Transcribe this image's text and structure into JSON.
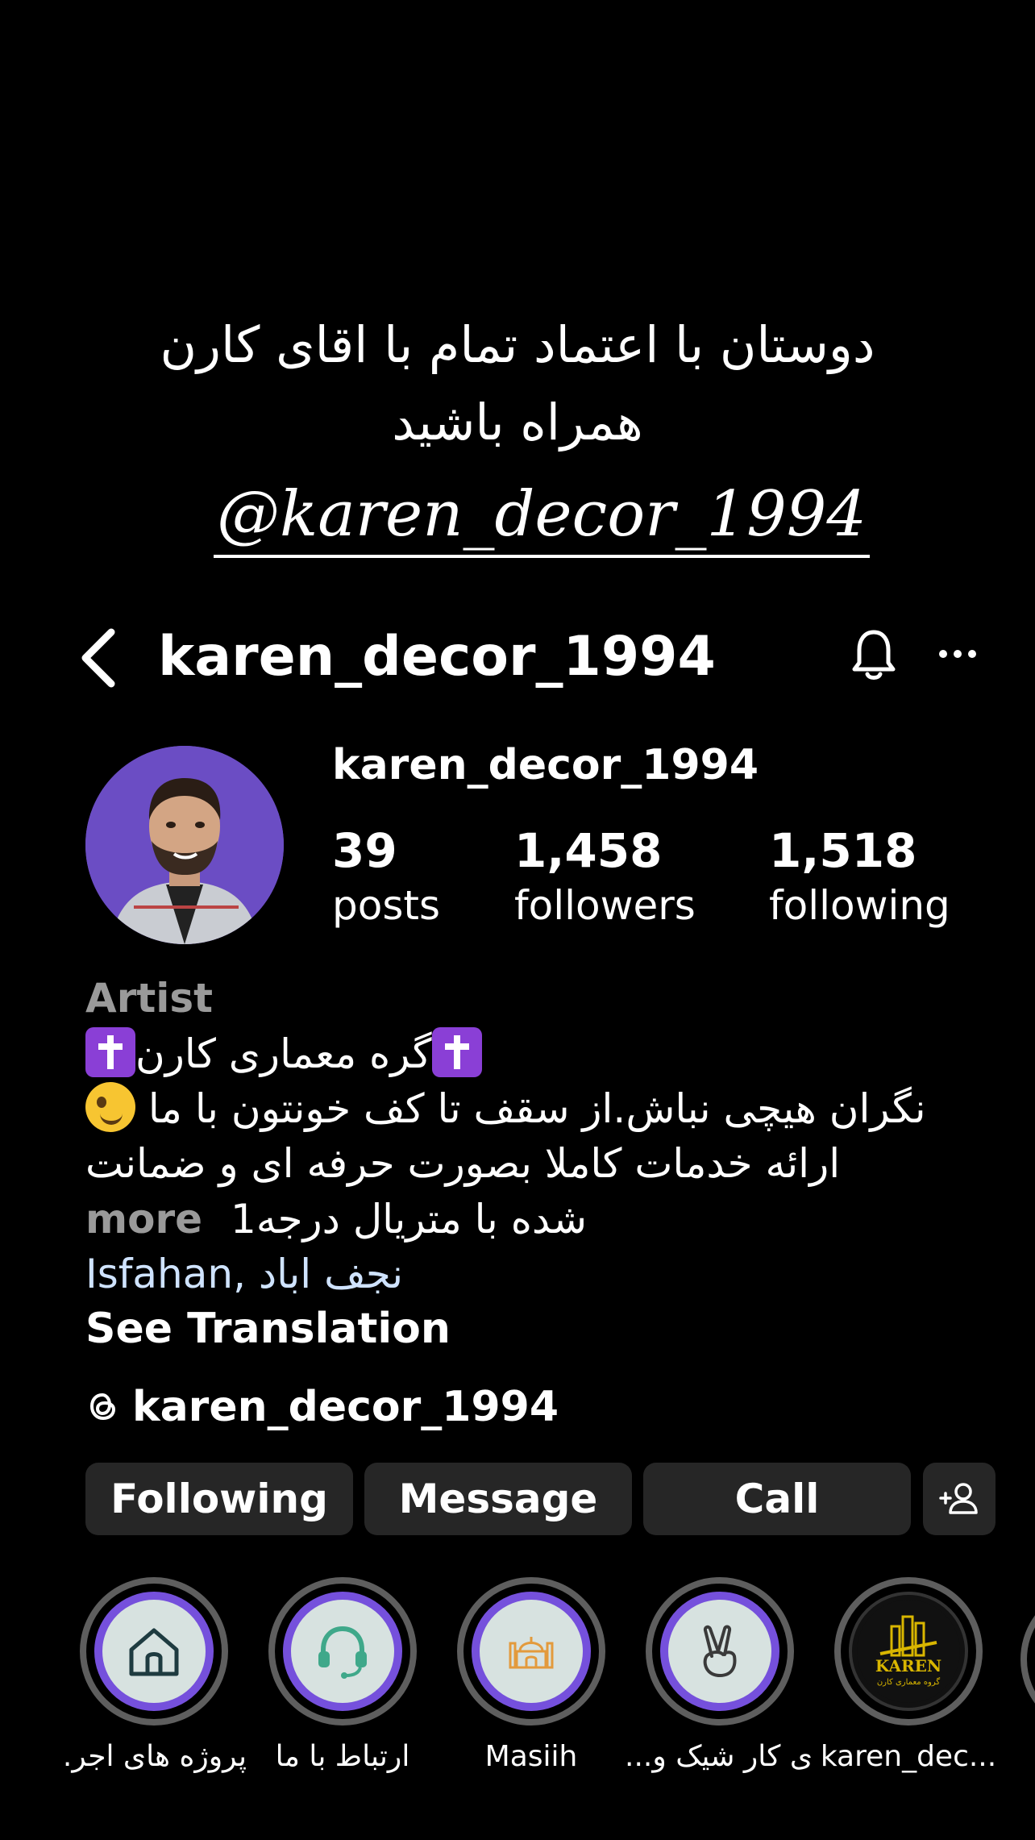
{
  "overlay": {
    "line1": "دوستان با اعتماد تمام با اقای کارن",
    "line2": "همراه باشید",
    "handle": "@karen_decor_1994"
  },
  "header": {
    "title": "karen_decor_1994"
  },
  "profile": {
    "name": "karen_decor_1994",
    "stats": {
      "posts_count": "39",
      "posts_label": "posts",
      "followers_count": "1,458",
      "followers_label": "followers",
      "following_count": "1,518",
      "following_label": "following"
    },
    "category": "Artist",
    "bio_line1": "گره معماری کارن",
    "bio_line2": "نگران هیچی نباش.از سقف تا کف خونتون با ما",
    "bio_line3": "ارائه خدمات کاملا بصورت حرفه ای و ضمانت",
    "bio_line4": "شده با متریال درجه1",
    "more_label": "more",
    "location_city": "Isfahan",
    "location_town": "نجف اباد",
    "see_translation": "See Translation",
    "threads_handle": "karen_decor_1994"
  },
  "actions": {
    "following_label": "Following",
    "message_label": "Message",
    "call_label": "Call"
  },
  "highlights": [
    {
      "label": "پروژه های اجر...",
      "icon": "house-icon"
    },
    {
      "label": "ارتباط با ما",
      "icon": "headset-icon"
    },
    {
      "label": "Masiih",
      "icon": "mosque-icon"
    },
    {
      "label": "ی کار شیک و...",
      "icon": "peace-hand-icon"
    },
    {
      "label": "karen_dec...",
      "icon": "karen-logo",
      "logo_text": "KAREN",
      "logo_subtitle": "گروه معماری کارن"
    }
  ],
  "colors": {
    "background": "#000000",
    "button": "#262626",
    "highlight_ring": "#7550dc",
    "location": "#cfe3ff",
    "muted": "#9a9a9a"
  }
}
